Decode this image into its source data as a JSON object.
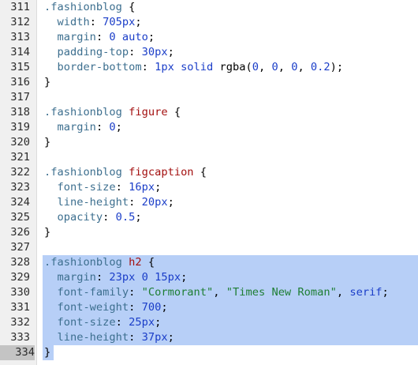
{
  "editor": {
    "lines": [
      {
        "n": "311",
        "tokens": [
          [
            "sel",
            ".fashionblog"
          ],
          [
            "pun",
            " {"
          ]
        ]
      },
      {
        "n": "312",
        "tokens": [
          [
            "plain",
            "  "
          ],
          [
            "prop",
            "width"
          ],
          [
            "pun",
            ": "
          ],
          [
            "val",
            "705px"
          ],
          [
            "pun",
            ";"
          ]
        ]
      },
      {
        "n": "313",
        "tokens": [
          [
            "plain",
            "  "
          ],
          [
            "prop",
            "margin"
          ],
          [
            "pun",
            ": "
          ],
          [
            "val",
            "0 auto"
          ],
          [
            "pun",
            ";"
          ]
        ]
      },
      {
        "n": "314",
        "tokens": [
          [
            "plain",
            "  "
          ],
          [
            "prop",
            "padding-top"
          ],
          [
            "pun",
            ": "
          ],
          [
            "val",
            "30px"
          ],
          [
            "pun",
            ";"
          ]
        ]
      },
      {
        "n": "315",
        "tokens": [
          [
            "plain",
            "  "
          ],
          [
            "prop",
            "border-bottom"
          ],
          [
            "pun",
            ": "
          ],
          [
            "val",
            "1px solid "
          ],
          [
            "plain",
            "rgba("
          ],
          [
            "val",
            "0"
          ],
          [
            "plain",
            ", "
          ],
          [
            "val",
            "0"
          ],
          [
            "plain",
            ", "
          ],
          [
            "val",
            "0"
          ],
          [
            "plain",
            ", "
          ],
          [
            "val",
            "0.2"
          ],
          [
            "plain",
            ")"
          ],
          [
            "pun",
            ";"
          ]
        ]
      },
      {
        "n": "316",
        "tokens": [
          [
            "pun",
            "}"
          ]
        ]
      },
      {
        "n": "317",
        "tokens": []
      },
      {
        "n": "318",
        "tokens": [
          [
            "sel",
            ".fashionblog "
          ],
          [
            "kw",
            "figure"
          ],
          [
            "pun",
            " {"
          ]
        ]
      },
      {
        "n": "319",
        "tokens": [
          [
            "plain",
            "  "
          ],
          [
            "prop",
            "margin"
          ],
          [
            "pun",
            ": "
          ],
          [
            "val",
            "0"
          ],
          [
            "pun",
            ";"
          ]
        ]
      },
      {
        "n": "320",
        "tokens": [
          [
            "pun",
            "}"
          ]
        ]
      },
      {
        "n": "321",
        "tokens": []
      },
      {
        "n": "322",
        "tokens": [
          [
            "sel",
            ".fashionblog "
          ],
          [
            "kw",
            "figcaption"
          ],
          [
            "pun",
            " {"
          ]
        ]
      },
      {
        "n": "323",
        "tokens": [
          [
            "plain",
            "  "
          ],
          [
            "prop",
            "font-size"
          ],
          [
            "pun",
            ": "
          ],
          [
            "val",
            "16px"
          ],
          [
            "pun",
            ";"
          ]
        ]
      },
      {
        "n": "324",
        "tokens": [
          [
            "plain",
            "  "
          ],
          [
            "prop",
            "line-height"
          ],
          [
            "pun",
            ": "
          ],
          [
            "val",
            "20px"
          ],
          [
            "pun",
            ";"
          ]
        ]
      },
      {
        "n": "325",
        "tokens": [
          [
            "plain",
            "  "
          ],
          [
            "prop",
            "opacity"
          ],
          [
            "pun",
            ": "
          ],
          [
            "val",
            "0.5"
          ],
          [
            "pun",
            ";"
          ]
        ]
      },
      {
        "n": "326",
        "tokens": [
          [
            "pun",
            "}"
          ]
        ]
      },
      {
        "n": "327",
        "tokens": []
      },
      {
        "n": "328",
        "selected": true,
        "tokens": [
          [
            "sel",
            ".fashionblog "
          ],
          [
            "kw",
            "h2"
          ],
          [
            "pun",
            " {"
          ]
        ]
      },
      {
        "n": "329",
        "selected": true,
        "tokens": [
          [
            "plain",
            "  "
          ],
          [
            "prop",
            "margin"
          ],
          [
            "pun",
            ": "
          ],
          [
            "val",
            "23px 0 15px"
          ],
          [
            "pun",
            ";"
          ]
        ]
      },
      {
        "n": "330",
        "selected": true,
        "tokens": [
          [
            "plain",
            "  "
          ],
          [
            "prop",
            "font-family"
          ],
          [
            "pun",
            ": "
          ],
          [
            "str",
            "\"Cormorant\""
          ],
          [
            "pun",
            ", "
          ],
          [
            "str",
            "\"Times New Roman\""
          ],
          [
            "pun",
            ", "
          ],
          [
            "val",
            "serif"
          ],
          [
            "pun",
            ";"
          ]
        ]
      },
      {
        "n": "331",
        "selected": true,
        "tokens": [
          [
            "plain",
            "  "
          ],
          [
            "prop",
            "font-weight"
          ],
          [
            "pun",
            ": "
          ],
          [
            "val",
            "700"
          ],
          [
            "pun",
            ";"
          ]
        ]
      },
      {
        "n": "332",
        "selected": true,
        "tokens": [
          [
            "plain",
            "  "
          ],
          [
            "prop",
            "font-size"
          ],
          [
            "pun",
            ": "
          ],
          [
            "val",
            "25px"
          ],
          [
            "pun",
            ";"
          ]
        ]
      },
      {
        "n": "333",
        "selected": true,
        "tokens": [
          [
            "plain",
            "  "
          ],
          [
            "prop",
            "line-height"
          ],
          [
            "pun",
            ": "
          ],
          [
            "val",
            "37px"
          ],
          [
            "pun",
            ";"
          ]
        ]
      },
      {
        "n": "334",
        "selected": true,
        "last": true,
        "current": true,
        "tokens": [
          [
            "pun",
            "}"
          ]
        ]
      }
    ]
  },
  "colors": {
    "selector": "#3d6f8f",
    "keyword": "#a30f0f",
    "property": "#3d6f8f",
    "value": "#1a3dc8",
    "string": "#1e7e34",
    "selection": "#b7cff7",
    "gutter": "#f0f0f0"
  }
}
